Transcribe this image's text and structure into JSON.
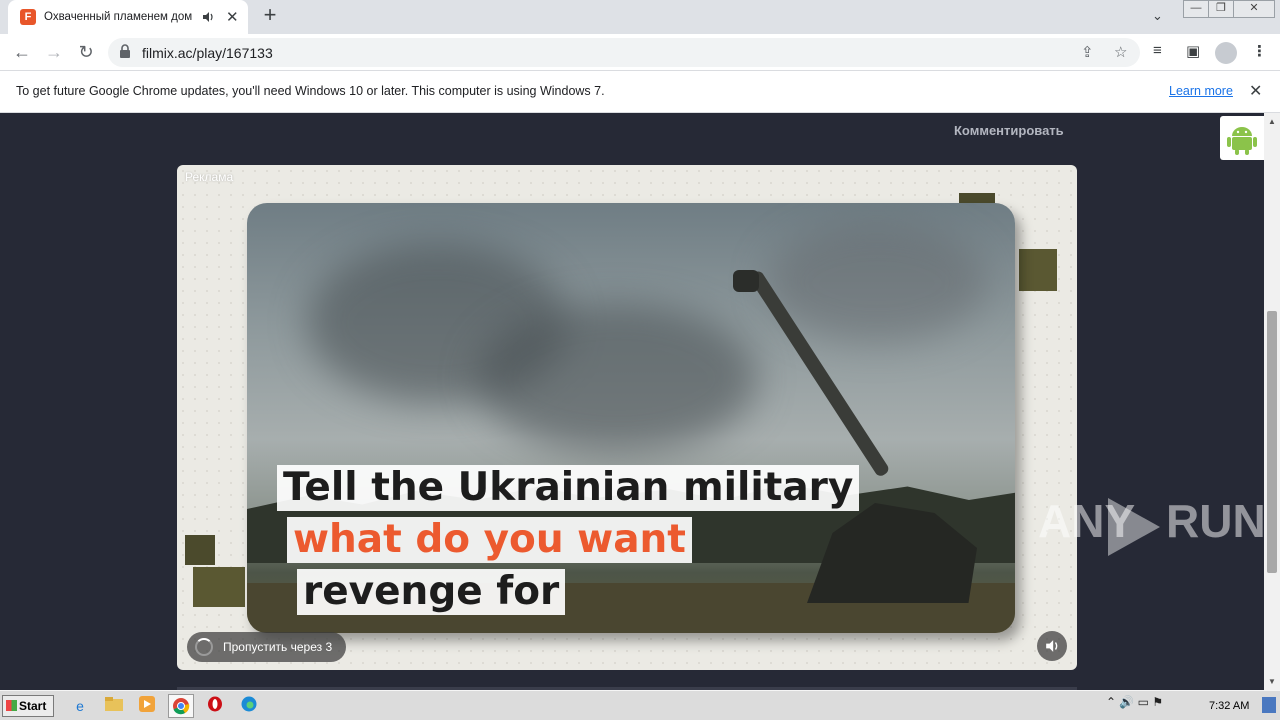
{
  "browser": {
    "tab": {
      "title": "Охваченный пламенем дом Мэр",
      "favicon_letter": "F",
      "audio_icon": "speaker-icon",
      "close_glyph": "✕"
    },
    "new_tab_glyph": "+",
    "tab_dropdown_glyph": "⌄",
    "window_controls": {
      "minimize": "—",
      "restore": "❐",
      "close": "✕"
    },
    "nav": {
      "back": "←",
      "forward": "→",
      "reload": "↻"
    },
    "address": {
      "url": "filmix.ac/play/167133"
    },
    "omnibox_icons": {
      "share": "⇪",
      "bookmark": "☆"
    },
    "toolbar_icons": {
      "media": "≡",
      "side_panel": "▣",
      "menu": "⋮"
    }
  },
  "infobar": {
    "message": "To get future Google Chrome updates, you'll need Windows 10 or later. This computer is using Windows 7.",
    "link": "Learn more",
    "close": "✕"
  },
  "page": {
    "comment_link": "Комментировать",
    "ad": {
      "label": "Реклама",
      "caption_line1": "Tell the Ukrainian military",
      "caption_line2": "what do you want",
      "caption_line3": "revenge for",
      "skip_label": "Пропустить через 3",
      "sound_glyph": "🔊"
    },
    "android_badge": "android-icon"
  },
  "watermark": {
    "text_left": "ANY",
    "text_right": "RUN"
  },
  "taskbar": {
    "start_label": "Start",
    "apps": [
      "ie-icon",
      "explorer-icon",
      "media-player-icon",
      "chrome-icon",
      "opera-icon",
      "edge-icon"
    ],
    "tray_glyphs": "⌃  🔊  ▭  ⚑",
    "clock": "7:32 AM"
  },
  "colors": {
    "page_bg": "#262936",
    "caption_orange": "#ec5a2f",
    "link_blue": "#1a73e8"
  }
}
